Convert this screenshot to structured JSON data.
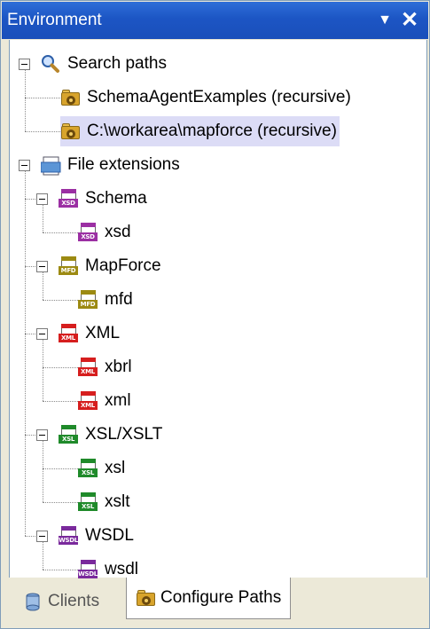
{
  "window": {
    "title": "Environment",
    "menu_glyph": "▼",
    "close_glyph": "✕"
  },
  "tree": {
    "search_paths": {
      "label": "Search paths",
      "icon": "magnifier-icon",
      "children": [
        {
          "label": "SchemaAgentExamples (recursive)",
          "icon": "folder-gear-icon"
        },
        {
          "label": "C:\\workarea\\mapforce (recursive)",
          "icon": "folder-gear-icon",
          "selected": true
        }
      ]
    },
    "file_extensions": {
      "label": "File extensions",
      "icon": "file-extensions-icon",
      "groups": [
        {
          "label": "Schema",
          "badge": "XSD",
          "color": "#9b2fa3",
          "children": [
            "xsd"
          ]
        },
        {
          "label": "MapForce",
          "badge": "MFD",
          "color": "#9c8a12",
          "children": [
            "mfd"
          ]
        },
        {
          "label": "XML",
          "badge": "XML",
          "color": "#d61e1e",
          "children": [
            "xbrl",
            "xml"
          ]
        },
        {
          "label": "XSL/XSLT",
          "badge": "XSL",
          "color": "#1f8a2a",
          "children": [
            "xsl",
            "xslt"
          ]
        },
        {
          "label": "WSDL",
          "badge": "WSDL",
          "color": "#7a2a9c",
          "children": [
            "wsdl"
          ]
        }
      ]
    }
  },
  "tabs": [
    {
      "label": "Clients",
      "icon": "clients-icon",
      "active": false
    },
    {
      "label": "Configure Paths",
      "icon": "configure-paths-icon",
      "active": true
    }
  ]
}
